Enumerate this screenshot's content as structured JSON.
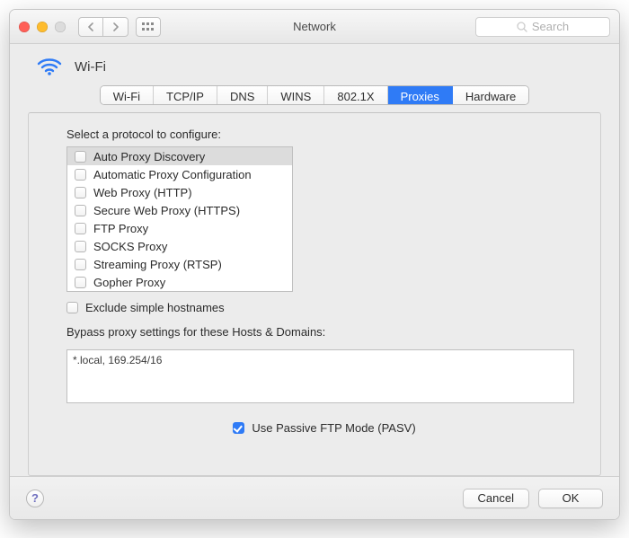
{
  "window": {
    "title": "Network",
    "search_placeholder": "Search"
  },
  "heading": {
    "interface": "Wi-Fi"
  },
  "tabs": [
    {
      "label": "Wi-Fi",
      "id": "wifi"
    },
    {
      "label": "TCP/IP",
      "id": "tcpip"
    },
    {
      "label": "DNS",
      "id": "dns"
    },
    {
      "label": "WINS",
      "id": "wins"
    },
    {
      "label": "802.1X",
      "id": "8021x"
    },
    {
      "label": "Proxies",
      "id": "proxies",
      "active": true
    },
    {
      "label": "Hardware",
      "id": "hardware"
    }
  ],
  "panel": {
    "protocol_label": "Select a protocol to configure:",
    "protocols": [
      {
        "label": "Auto Proxy Discovery",
        "checked": false,
        "selected": true
      },
      {
        "label": "Automatic Proxy Configuration",
        "checked": false,
        "selected": false
      },
      {
        "label": "Web Proxy (HTTP)",
        "checked": false,
        "selected": false
      },
      {
        "label": "Secure Web Proxy (HTTPS)",
        "checked": false,
        "selected": false
      },
      {
        "label": "FTP Proxy",
        "checked": false,
        "selected": false
      },
      {
        "label": "SOCKS Proxy",
        "checked": false,
        "selected": false
      },
      {
        "label": "Streaming Proxy (RTSP)",
        "checked": false,
        "selected": false
      },
      {
        "label": "Gopher Proxy",
        "checked": false,
        "selected": false
      }
    ],
    "exclude_simple_label": "Exclude simple hostnames",
    "exclude_simple_checked": false,
    "bypass_label": "Bypass proxy settings for these Hosts & Domains:",
    "bypass_value": "*.local, 169.254/16",
    "pasv_label": "Use Passive FTP Mode (PASV)",
    "pasv_checked": true
  },
  "footer": {
    "help_glyph": "?",
    "cancel": "Cancel",
    "ok": "OK"
  }
}
